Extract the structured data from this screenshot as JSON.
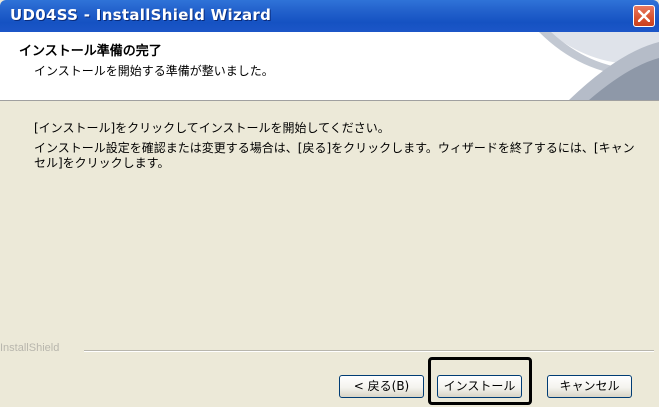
{
  "window": {
    "title": "UD04SS - InstallShield Wizard",
    "close_icon": "close-icon"
  },
  "header": {
    "title": "インストール準備の完了",
    "subtitle": "インストールを開始する準備が整いました。"
  },
  "body": {
    "line1": "[インストール]をクリックしてインストールを開始してください。",
    "line2": "インストール設定を確認または変更する場合は、[戻る]をクリックします。ウィザードを終了するには、[キャンセル]をクリックします。"
  },
  "footer": {
    "brand": "InstallShield",
    "back_label": "< 戻る(B)",
    "install_label": "インストール",
    "cancel_label": "キャンセル"
  },
  "colors": {
    "titlebar": "#1c56c8",
    "close": "#d8532f",
    "highlight": "#000000"
  }
}
